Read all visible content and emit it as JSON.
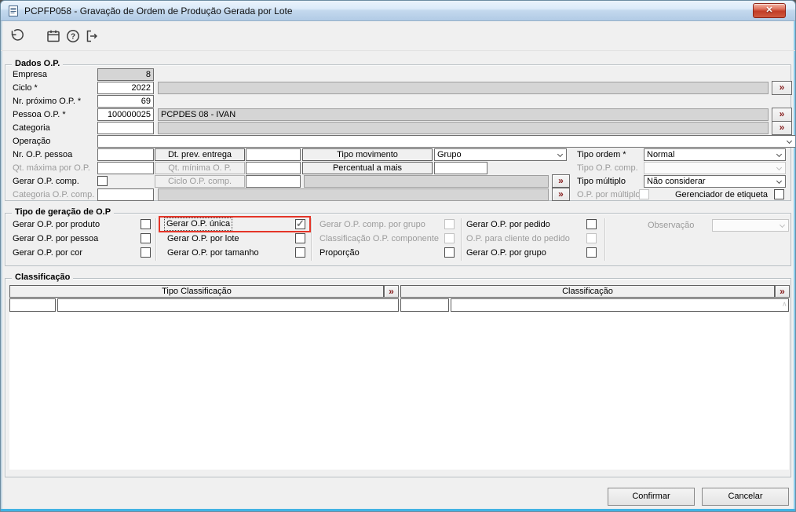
{
  "window": {
    "title": "PCPFP058 - Gravação de Ordem de Produção Gerada por Lote",
    "close_glyph": "✕"
  },
  "ui": {
    "lookup_glyph": "»",
    "scroll_up_glyph": "∧"
  },
  "dados_op": {
    "legend": "Dados O.P.",
    "empresa": {
      "label": "Empresa",
      "value": "8"
    },
    "ciclo": {
      "label": "Ciclo *",
      "value": "2022",
      "desc": ""
    },
    "nr_proximo_op": {
      "label": "Nr. próximo O.P. *",
      "value": "69"
    },
    "pessoa_op": {
      "label": "Pessoa O.P. *",
      "value": "100000025",
      "desc": "PCPDES 08 - IVAN"
    },
    "categoria": {
      "label": "Categoria",
      "value": "",
      "desc": ""
    },
    "operacao": {
      "label": "Operação",
      "value": ""
    },
    "nr_op_pessoa": {
      "label": "Nr. O.P. pessoa",
      "value": ""
    },
    "dt_prev_entrega": {
      "label": "Dt. prev. entrega",
      "value": ""
    },
    "tipo_movimento": {
      "label": "Tipo movimento",
      "value": "Grupo"
    },
    "tipo_ordem": {
      "label": "Tipo ordem *",
      "value": "Normal"
    },
    "qt_maxima": {
      "label": "Qt. máxima por O.P.",
      "value": ""
    },
    "qt_minima": {
      "label": "Qt. mínima O. P.",
      "value": ""
    },
    "percentual_a_mais": {
      "label": "Percentual a mais",
      "value": ""
    },
    "tipo_op_comp": {
      "label": "Tipo O.P. comp.",
      "value": ""
    },
    "gerar_op_comp": {
      "label": "Gerar O.P. comp.",
      "checked": false
    },
    "ciclo_op_comp": {
      "label": "Ciclo O.P. comp.",
      "value": "",
      "desc": ""
    },
    "tipo_multiplo": {
      "label": "Tipo múltiplo",
      "value": "Não considerar"
    },
    "categoria_op_comp": {
      "label": "Categoria O.P. comp.",
      "value": "",
      "desc": ""
    },
    "op_por_multiplo": {
      "label": "O.P. por múltiplo",
      "checked": false
    },
    "gerenciador_etiqueta": {
      "label": "Gerenciador de etiqueta",
      "checked": false
    }
  },
  "tipo_geracao": {
    "legend": "Tipo de geração de O.P",
    "items": [
      {
        "label": "Gerar O.P. por produto",
        "checked": false,
        "disabled": false
      },
      {
        "label": "Gerar O.P. por pessoa",
        "checked": false,
        "disabled": false
      },
      {
        "label": "Gerar O.P. por cor",
        "checked": false,
        "disabled": false
      },
      {
        "label": "Gerar O.P. única",
        "checked": true,
        "disabled": false,
        "highlighted": true
      },
      {
        "label": "Gerar O.P. por lote",
        "checked": false,
        "disabled": false
      },
      {
        "label": "Gerar O.P. por tamanho",
        "checked": false,
        "disabled": false
      },
      {
        "label": "Gerar O.P. comp. por grupo",
        "checked": false,
        "disabled": true
      },
      {
        "label": "Classificação O.P. componente",
        "checked": false,
        "disabled": true
      },
      {
        "label": "Proporção",
        "checked": false,
        "disabled": false
      },
      {
        "label": "Gerar O.P. por pedido",
        "checked": false,
        "disabled": false
      },
      {
        "label": "O.P. para cliente do pedido",
        "checked": false,
        "disabled": true
      },
      {
        "label": "Gerar O.P. por grupo",
        "checked": false,
        "disabled": false
      }
    ],
    "observacao": {
      "label": "Observação",
      "value": ""
    }
  },
  "classificacao": {
    "legend": "Classificação",
    "columns": [
      {
        "header": "Tipo Classificação"
      },
      {
        "header": "Classificação"
      }
    ],
    "rows": [
      {
        "c1": "",
        "c2": "",
        "c3": "",
        "c4": ""
      }
    ]
  },
  "footer": {
    "confirm_label": "Confirmar",
    "cancel_label": "Cancelar"
  }
}
